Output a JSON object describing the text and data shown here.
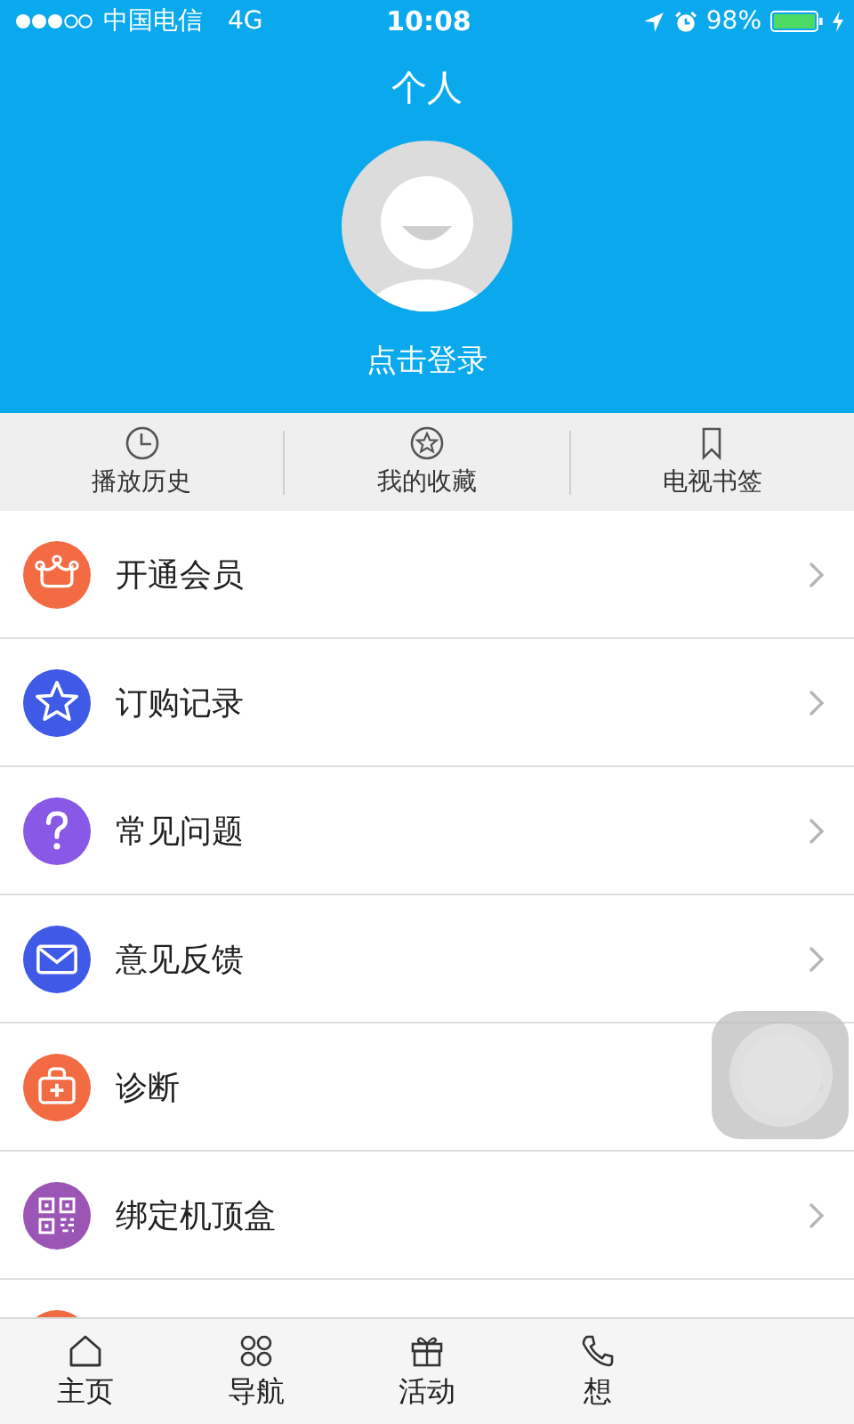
{
  "status_bar": {
    "carrier": "中国电信",
    "network": "4G",
    "time": "10:08",
    "battery": "98%"
  },
  "header": {
    "title": "个人",
    "login": "点击登录"
  },
  "shortcuts": [
    {
      "label": "播放历史"
    },
    {
      "label": "我的收藏"
    },
    {
      "label": "电视书签"
    }
  ],
  "menu": [
    {
      "label": "开通会员",
      "color": "#f26b43"
    },
    {
      "label": "订购记录",
      "color": "#3f5ae6"
    },
    {
      "label": "常见问题",
      "color": "#8a58e6"
    },
    {
      "label": "意见反馈",
      "color": "#3f5ae6"
    },
    {
      "label": "诊断",
      "color": "#f26b43"
    },
    {
      "label": "绑定机顶盒",
      "color": "#9b55b5"
    },
    {
      "color": "#f26b43"
    }
  ],
  "tab_bar": [
    {
      "label": "主页"
    },
    {
      "label": "导航"
    },
    {
      "label": "活动"
    },
    {
      "label": "想"
    }
  ]
}
